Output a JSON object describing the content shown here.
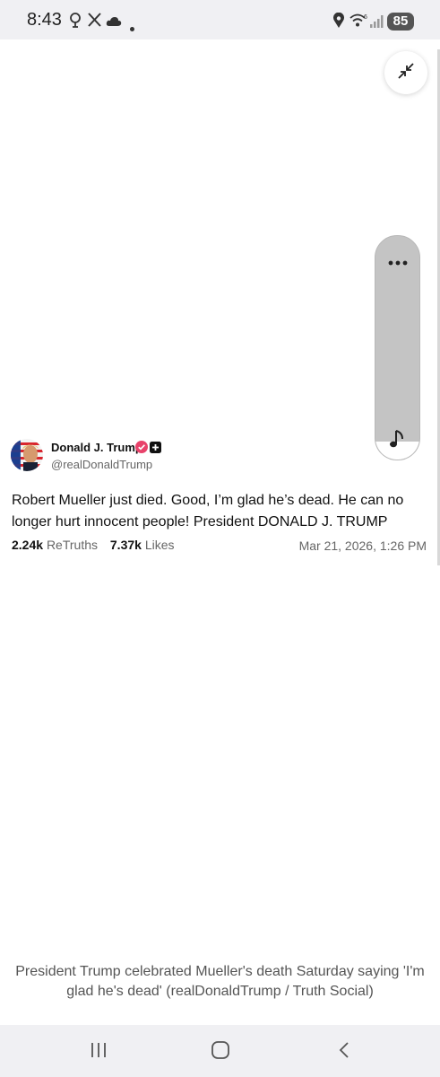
{
  "status_bar": {
    "time": "8:43",
    "left_icons": [
      "location-pin-icon",
      "x-logo-icon",
      "cloud-icon",
      "dot-icon"
    ],
    "right_icons": [
      "location-icon",
      "wifi-6-icon",
      "signal-icon"
    ],
    "battery": "85"
  },
  "viewer": {
    "minimize_icon": "minimize-icon",
    "side_panel": {
      "more_icon": "more-dots-icon",
      "music_icon": "music-note-icon"
    }
  },
  "post": {
    "author_name": "Donald J. Trump",
    "handle": "@realDonaldTrump",
    "body": "Robert Mueller just died. Good, I’m glad he’s dead. He can no longer hurt innocent people! President DONALD J. TRUMP",
    "retruths_count": "2.24k",
    "retruths_label": "ReTruths",
    "likes_count": "7.37k",
    "likes_label": "Likes",
    "date": "Mar 21, 2026, 1:26 PM",
    "verified_color": "#e8436b"
  },
  "caption": "President Trump celebrated Mueller's death Saturday saying 'I'm glad he's dead' (realDonaldTrump / Truth Social)",
  "nav_bar": {
    "buttons": [
      "recents-icon",
      "home-icon",
      "back-icon"
    ]
  }
}
